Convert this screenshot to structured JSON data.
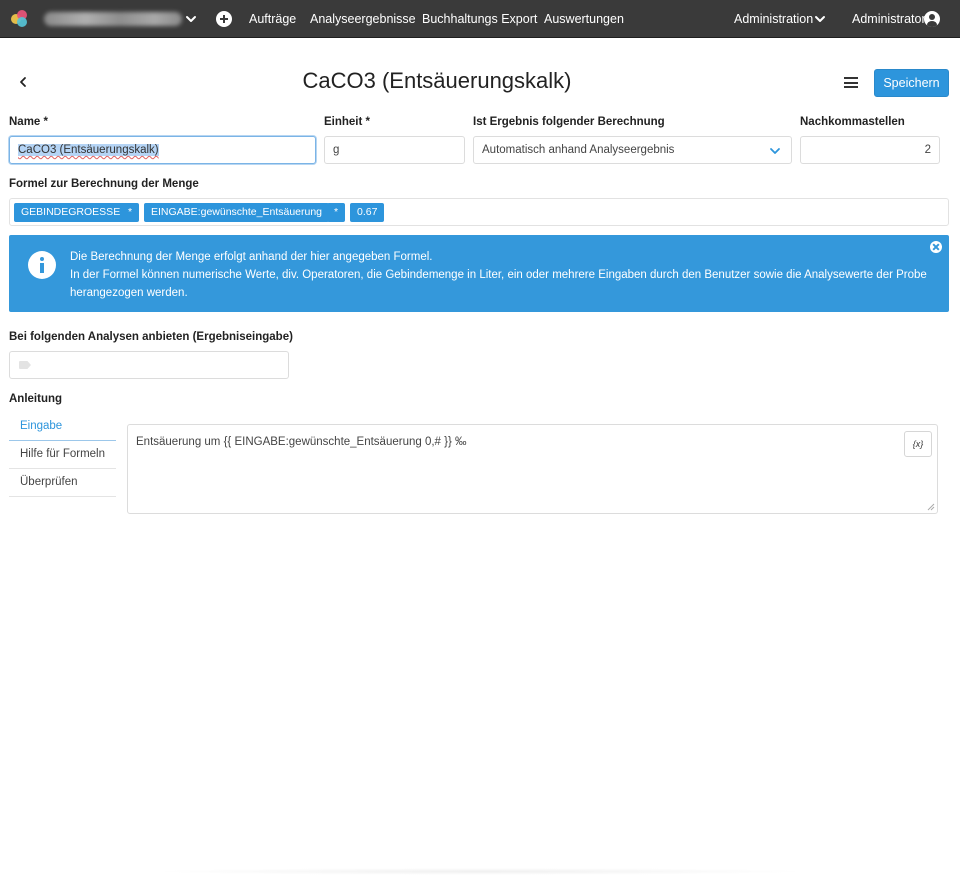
{
  "nav": {
    "links": [
      "Aufträge",
      "Analyseergebnisse",
      "Buchhaltungs Export",
      "Auswertungen"
    ],
    "admin_menu": "Administration",
    "user": "Administrator"
  },
  "header": {
    "title": "CaCO3 (Entsäuerungskalk)",
    "save_label": "Speichern"
  },
  "form": {
    "name_label": "Name *",
    "name_value": "CaCO3 (Entsäuerungskalk)",
    "unit_label": "Einheit *",
    "unit_value": "g",
    "calc_label": "Ist Ergebnis folgender Berechnung",
    "calc_value": "Automatisch anhand Analyseergebnis",
    "decimals_label": "Nachkommastellen",
    "decimals_value": "2",
    "formula_label": "Formel zur Berechnung der Menge",
    "formula_tokens": [
      "GEBINDEGROESSE",
      "*",
      "EINGABE:gewünschte_Entsäuerung",
      "*",
      "0.67"
    ]
  },
  "alert": {
    "line1": "Die Berechnung der Menge erfolgt anhand der hier angegeben Formel.",
    "line2": "In der Formel können numerische Werte, div. Operatoren, die Gebindemenge in Liter, ein oder mehrere Eingaben durch den Benutzer sowie die Analysewerte der Probe herangezogen werden."
  },
  "analyses": {
    "label": "Bei folgenden Analysen anbieten (Ergebniseingabe)"
  },
  "instructions": {
    "label": "Anleitung",
    "tabs": [
      "Eingabe",
      "Hilfe für Formeln",
      "Überprüfen"
    ],
    "text": "Entsäuerung um {{ EINGABE:gewünschte_Entsäuerung 0,# }} ‰",
    "var_button": "{x}"
  },
  "colors": {
    "primary": "#2d95dc",
    "alert_bg": "#3498db",
    "navbar_bg": "#3a3a3a"
  }
}
